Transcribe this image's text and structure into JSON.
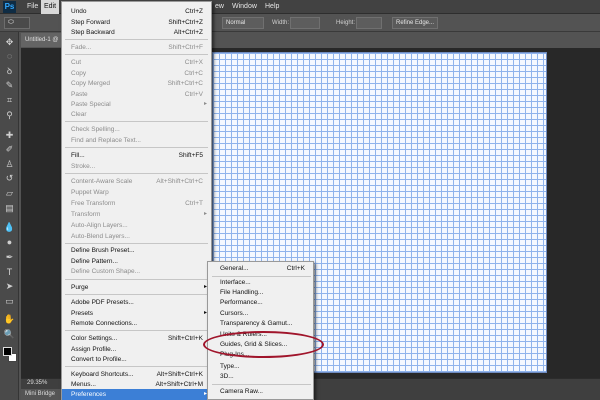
{
  "app": {
    "logo": "Ps"
  },
  "menubar": {
    "items": [
      "File",
      "Edit",
      "ew",
      "Window",
      "Help"
    ]
  },
  "options": {
    "tool": "⬭",
    "style_label": "",
    "style_value": "Normal",
    "width_label": "Width:",
    "height_label": "Height:",
    "refine_button": "Refine Edge..."
  },
  "document": {
    "tab": "Untitled-1 @",
    "zoom": "29.35%",
    "bridge_tab": "Mini Bridge"
  },
  "edit_menu": {
    "items": [
      {
        "label": "Undo",
        "shortcut": "Ctrl+Z",
        "disabled": false
      },
      {
        "label": "Step Forward",
        "shortcut": "Shift+Ctrl+Z",
        "disabled": false
      },
      {
        "label": "Step Backward",
        "shortcut": "Alt+Ctrl+Z",
        "disabled": false
      },
      {
        "label": "Fade...",
        "shortcut": "Shift+Ctrl+F",
        "disabled": true
      },
      {
        "label": "Cut",
        "shortcut": "Ctrl+X",
        "disabled": true
      },
      {
        "label": "Copy",
        "shortcut": "Ctrl+C",
        "disabled": true
      },
      {
        "label": "Copy Merged",
        "shortcut": "Shift+Ctrl+C",
        "disabled": true
      },
      {
        "label": "Paste",
        "shortcut": "Ctrl+V",
        "disabled": true
      },
      {
        "label": "Paste Special",
        "shortcut": "",
        "disabled": true
      },
      {
        "label": "Clear",
        "shortcut": "",
        "disabled": true
      },
      {
        "label": "Check Spelling...",
        "shortcut": "",
        "disabled": true
      },
      {
        "label": "Find and Replace Text...",
        "shortcut": "",
        "disabled": true
      },
      {
        "label": "Fill...",
        "shortcut": "Shift+F5",
        "disabled": false
      },
      {
        "label": "Stroke...",
        "shortcut": "",
        "disabled": true
      },
      {
        "label": "Content-Aware Scale",
        "shortcut": "Alt+Shift+Ctrl+C",
        "disabled": true
      },
      {
        "label": "Puppet Warp",
        "shortcut": "",
        "disabled": true
      },
      {
        "label": "Free Transform",
        "shortcut": "Ctrl+T",
        "disabled": true
      },
      {
        "label": "Transform",
        "shortcut": "",
        "disabled": true
      },
      {
        "label": "Auto-Align Layers...",
        "shortcut": "",
        "disabled": true
      },
      {
        "label": "Auto-Blend Layers...",
        "shortcut": "",
        "disabled": true
      },
      {
        "label": "Define Brush Preset...",
        "shortcut": "",
        "disabled": false
      },
      {
        "label": "Define Pattern...",
        "shortcut": "",
        "disabled": false
      },
      {
        "label": "Define Custom Shape...",
        "shortcut": "",
        "disabled": true
      },
      {
        "label": "Purge",
        "shortcut": "",
        "disabled": false
      },
      {
        "label": "Adobe PDF Presets...",
        "shortcut": "",
        "disabled": false
      },
      {
        "label": "Presets",
        "shortcut": "",
        "disabled": false
      },
      {
        "label": "Remote Connections...",
        "shortcut": "",
        "disabled": false
      },
      {
        "label": "Color Settings...",
        "shortcut": "Shift+Ctrl+K",
        "disabled": false
      },
      {
        "label": "Assign Profile...",
        "shortcut": "",
        "disabled": false
      },
      {
        "label": "Convert to Profile...",
        "shortcut": "",
        "disabled": false
      },
      {
        "label": "Keyboard Shortcuts...",
        "shortcut": "Alt+Shift+Ctrl+K",
        "disabled": false
      },
      {
        "label": "Menus...",
        "shortcut": "Alt+Shift+Ctrl+M",
        "disabled": false
      },
      {
        "label": "Preferences",
        "shortcut": "",
        "disabled": false
      }
    ]
  },
  "preferences_menu": {
    "items": [
      {
        "label": "General...",
        "shortcut": "Ctrl+K"
      },
      {
        "label": "Interface...",
        "shortcut": ""
      },
      {
        "label": "File Handling...",
        "shortcut": ""
      },
      {
        "label": "Performance...",
        "shortcut": ""
      },
      {
        "label": "Cursors...",
        "shortcut": ""
      },
      {
        "label": "Transparency & Gamut...",
        "shortcut": ""
      },
      {
        "label": "Units & Rulers...",
        "shortcut": ""
      },
      {
        "label": "Guides, Grid & Slices...",
        "shortcut": ""
      },
      {
        "label": "Plug-Ins...",
        "shortcut": ""
      },
      {
        "label": "Type...",
        "shortcut": ""
      },
      {
        "label": "3D...",
        "shortcut": ""
      },
      {
        "label": "Camera Raw...",
        "shortcut": ""
      }
    ]
  },
  "colors": {
    "highlight": "#3c7fd6",
    "annotation_circle": "#a0152b",
    "grid": "#8fb3ec"
  },
  "icons": [
    "move-icon",
    "marquee-icon",
    "lasso-icon",
    "quick-select-icon",
    "crop-icon",
    "eyedropper-icon",
    "healing-brush-icon",
    "brush-icon",
    "clone-stamp-icon",
    "history-brush-icon",
    "eraser-icon",
    "gradient-icon",
    "blur-icon",
    "dodge-icon",
    "pen-icon",
    "type-icon",
    "path-select-icon",
    "shape-icon",
    "hand-icon",
    "zoom-icon"
  ]
}
